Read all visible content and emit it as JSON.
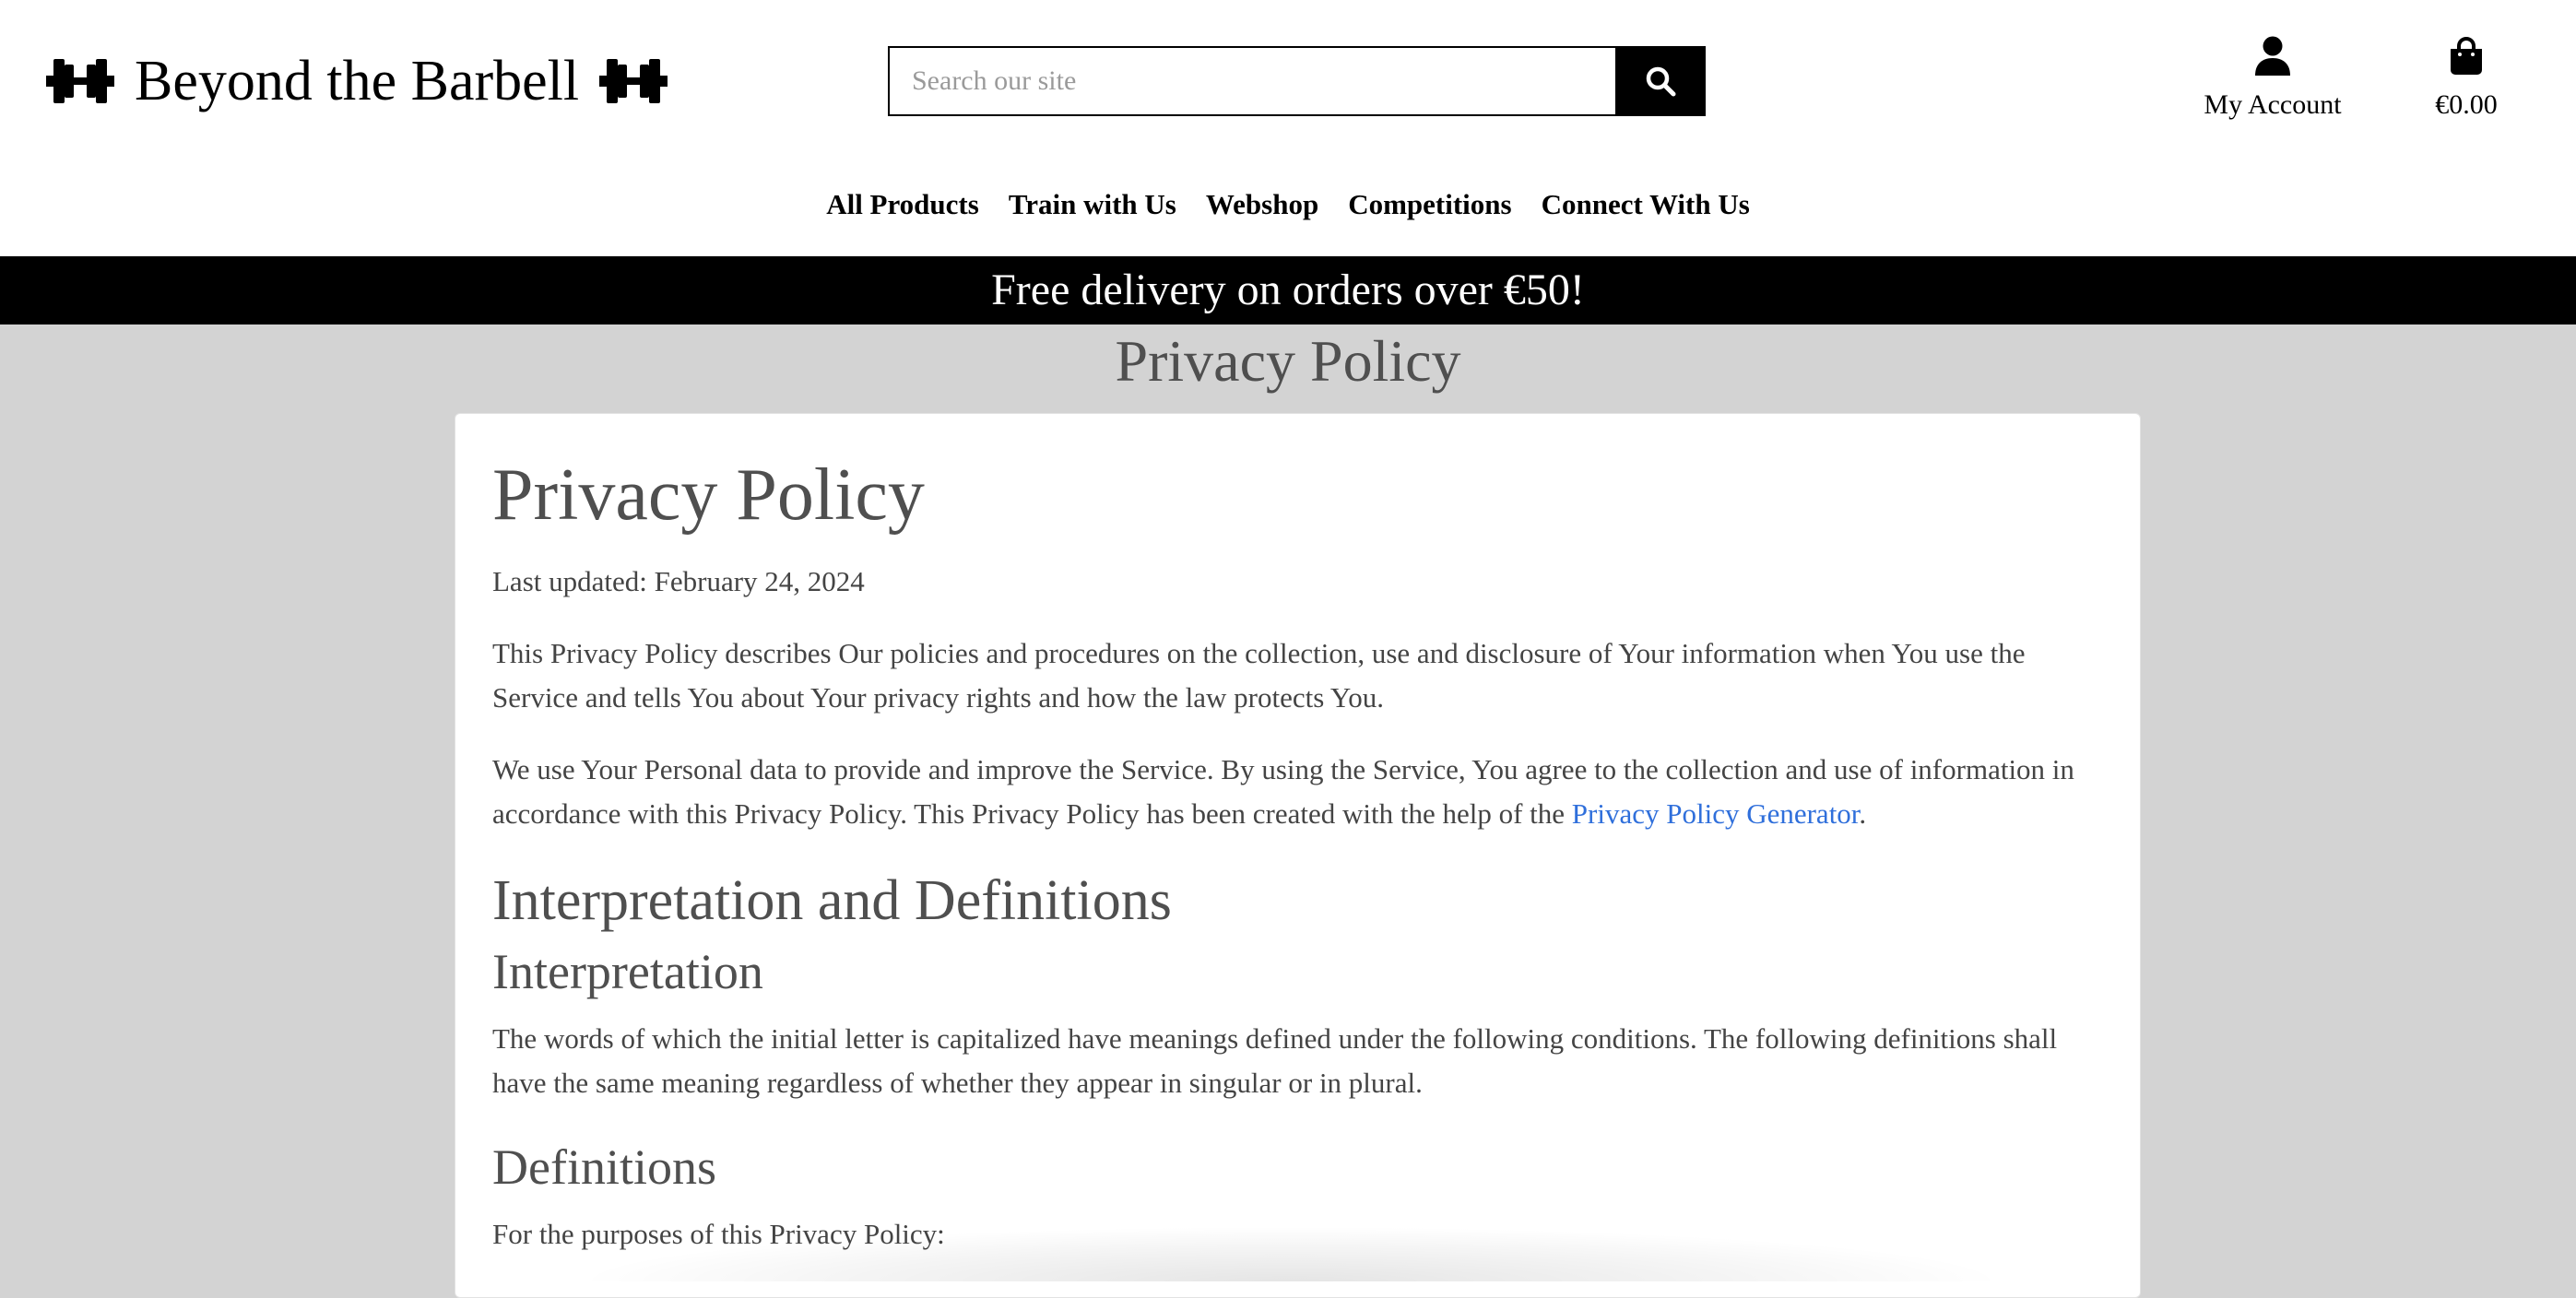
{
  "brand": {
    "name": "Beyond the Barbell",
    "icon": "dumbbell-icon"
  },
  "search": {
    "placeholder": "Search our site",
    "value": "",
    "icon": "search-icon"
  },
  "account": {
    "label": "My Account",
    "icon": "user-icon"
  },
  "cart": {
    "total": "€0.00",
    "icon": "shopping-bag-icon"
  },
  "nav": {
    "items": [
      {
        "label": "All Products"
      },
      {
        "label": "Train with Us"
      },
      {
        "label": "Webshop"
      },
      {
        "label": "Competitions"
      },
      {
        "label": "Connect With Us"
      }
    ]
  },
  "promo": {
    "text": "Free delivery on orders over €50!"
  },
  "page": {
    "heading": "Privacy Policy"
  },
  "policy": {
    "title": "Privacy Policy",
    "last_updated": "Last updated: February 24, 2024",
    "intro": "This Privacy Policy describes Our policies and procedures on the collection, use and disclosure of Your information when You use the Service and tells You about Your privacy rights and how the law protects You.",
    "usage_text": "We use Your Personal data to provide and improve the Service. By using the Service, You agree to the collection and use of information in accordance with this Privacy Policy. This Privacy Policy has been created with the help of the ",
    "generator_link": "Privacy Policy Generator",
    "usage_end": ".",
    "section_title": "Interpretation and Definitions",
    "interpretation_title": "Interpretation",
    "interpretation_text": "The words of which the initial letter is capitalized have meanings defined under the following conditions. The following definitions shall have the same meaning regardless of whether they appear in singular or in plural.",
    "definitions_title": "Definitions",
    "definitions_intro": "For the purposes of this Privacy Policy:"
  },
  "colors": {
    "promo_background": "#000000",
    "page_background": "#d3d3d3",
    "link": "#2f6fdb",
    "heading_text": "#4f4f4f"
  }
}
